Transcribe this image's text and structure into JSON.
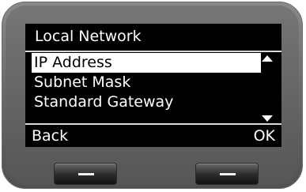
{
  "screen": {
    "title": "Local Network",
    "menu_items": [
      {
        "label": "IP Address",
        "selected": true
      },
      {
        "label": "Subnet Mask",
        "selected": false
      },
      {
        "label": "Standard Gateway",
        "selected": false
      }
    ],
    "softkeys": {
      "left": "Back",
      "right": "OK"
    }
  },
  "icons": {
    "scroll_up": "scroll-up-arrow-icon",
    "scroll_down": "scroll-down-arrow-icon",
    "hw_left": "minus-icon",
    "hw_right": "minus-icon"
  },
  "colors": {
    "screen_bg": "#000000",
    "text": "#ffffff",
    "highlight_bg": "#ffffff",
    "highlight_text": "#000000",
    "device_body": "#6c6c6c"
  }
}
